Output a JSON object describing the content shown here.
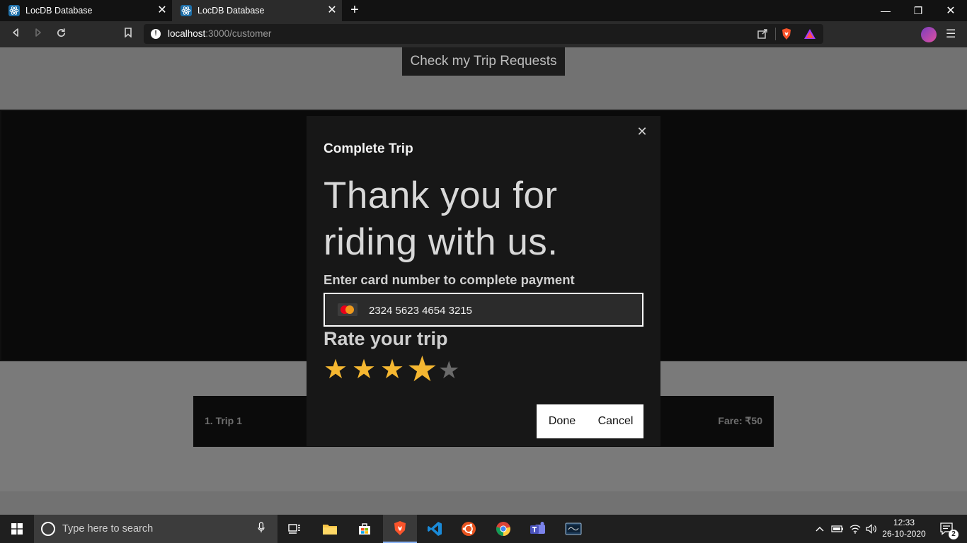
{
  "browser": {
    "tabs": [
      {
        "title": "LocDB Database",
        "active": false
      },
      {
        "title": "LocDB Database",
        "active": true
      }
    ],
    "url_host": "localhost",
    "url_path": ":3000/customer",
    "window_controls": {
      "minimize": "minimize-icon",
      "restore": "restore-icon",
      "close": "close-icon"
    }
  },
  "page": {
    "check_trip_requests_label": "Check my Trip Requests",
    "trip_row": {
      "name": "1. Trip 1",
      "fare": "Fare: ₹50"
    }
  },
  "modal": {
    "title": "Complete Trip",
    "thank_you_line1": "Thank you for",
    "thank_you_line2": "riding with us.",
    "payment_label": "Enter card number to complete payment",
    "card_number": "2324 5623 4654 3215",
    "card_brand_icon": "mastercard-icon",
    "rating_label": "Rate your trip",
    "rating": {
      "value": 4,
      "max": 5
    },
    "done_label": "Done",
    "cancel_label": "Cancel"
  },
  "taskbar": {
    "search_placeholder": "Type here to search",
    "time": "12:33",
    "date": "26-10-2020",
    "notification_count": "2"
  },
  "colors": {
    "star_filled": "#f5b731",
    "star_empty": "#6a6a6a",
    "modal_bg": "#171717",
    "page_bg": "#727272"
  }
}
